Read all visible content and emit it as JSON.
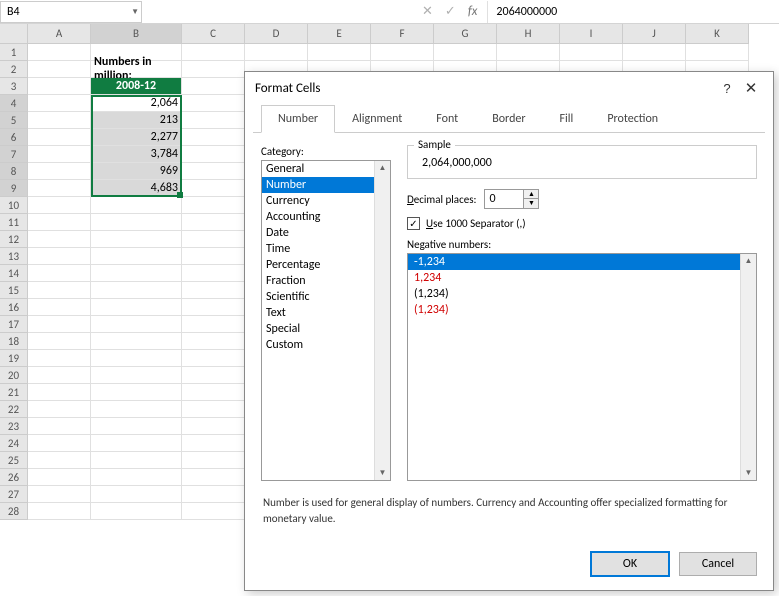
{
  "namebox": "B4",
  "formula": "2064000000",
  "columns": [
    "A",
    "B",
    "C",
    "D",
    "E",
    "F",
    "G",
    "H",
    "I",
    "J",
    "K"
  ],
  "rows": [
    "1",
    "2",
    "3",
    "4",
    "5",
    "6",
    "7",
    "8",
    "9",
    "10",
    "11",
    "12",
    "13",
    "14",
    "15",
    "16",
    "17",
    "18",
    "19",
    "20",
    "21",
    "22",
    "23",
    "24",
    "25",
    "26",
    "27",
    "28"
  ],
  "sheet": {
    "b2": "Numbers in million:",
    "b3": "2008-12",
    "b4": "2,064",
    "b5": "213",
    "b6": "2,277",
    "b7": "3,784",
    "b8": "969",
    "b9": "4,683"
  },
  "fx": {
    "cancel": "✕",
    "enter": "✓",
    "label": "fx"
  },
  "dialog": {
    "title": "Format Cells",
    "help": "?",
    "close": "✕",
    "tabs": [
      "Number",
      "Alignment",
      "Font",
      "Border",
      "Fill",
      "Protection"
    ],
    "active_tab": 0,
    "category_label": "Category:",
    "categories": [
      "General",
      "Number",
      "Currency",
      "Accounting",
      "Date",
      "Time",
      "Percentage",
      "Fraction",
      "Scientific",
      "Text",
      "Special",
      "Custom"
    ],
    "category_selected": 1,
    "sample_label": "Sample",
    "sample_value": "2,064,000,000",
    "decimal_label": "Decimal places:",
    "decimal_value": "0",
    "separator_checked": true,
    "separator_label": "Use 1000 Separator (,)",
    "negative_label": "Negative numbers:",
    "negatives": [
      "-1,234",
      "1,234",
      "(1,234)",
      "(1,234)"
    ],
    "negative_red": [
      false,
      true,
      false,
      true
    ],
    "negative_selected": 0,
    "description": "Number is used for general display of numbers.  Currency and Accounting offer specialized formatting for monetary value.",
    "ok": "OK",
    "cancel": "Cancel"
  }
}
